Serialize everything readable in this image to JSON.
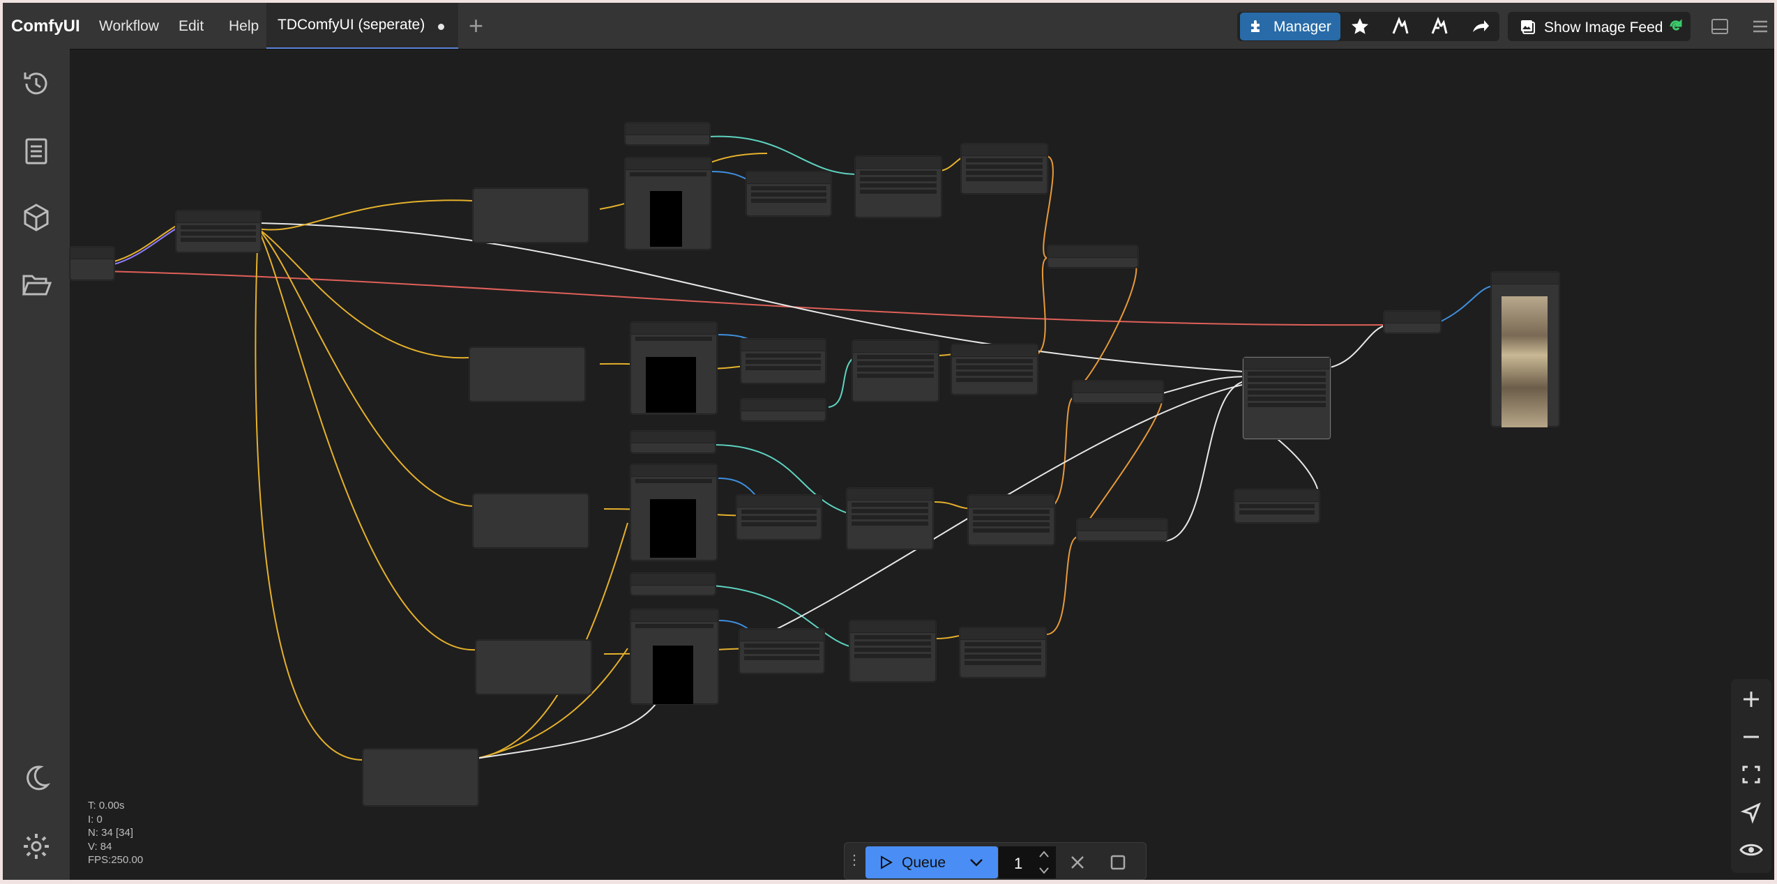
{
  "app": {
    "brand": "ComfyUI"
  },
  "menu": {
    "workflow": "Workflow",
    "edit": "Edit",
    "help": "Help"
  },
  "tabs": [
    {
      "label": "TDComfyUI (seperate)",
      "modified": true
    }
  ],
  "toolbar": {
    "manager_label": "Manager",
    "image_feed_label": "Show Image Feed"
  },
  "sidebar": {
    "items": [
      "history",
      "workflow",
      "model-library",
      "queue-folder"
    ],
    "bottom": [
      "theme-toggle",
      "settings"
    ]
  },
  "stats": {
    "t": "T: 0.00s",
    "i": "I: 0",
    "n": "N: 34 [34]",
    "v": "V: 84",
    "fps": "FPS:250.00"
  },
  "queue": {
    "label": "Queue",
    "count": "1"
  },
  "colors": {
    "accent": "#4a8ef5",
    "manager": "#286ba8",
    "link_yellow": "#e6b12c",
    "link_white": "#e8e8e8",
    "link_cyan": "#5ed3c0",
    "link_red": "#e0605a",
    "link_blue": "#3f90e0",
    "link_orange": "#e89a3a"
  },
  "icons": [
    "history-icon",
    "document-icon",
    "cube-icon",
    "folder-open-icon",
    "moon-icon",
    "gear-icon",
    "puzzle-icon",
    "star-icon",
    "plus-icon",
    "zoom-in-icon",
    "zoom-out-icon",
    "fit-view-icon",
    "locate-icon",
    "eye-icon"
  ]
}
